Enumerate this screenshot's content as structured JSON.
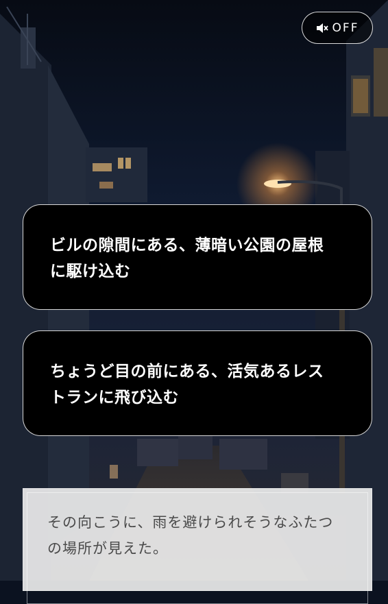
{
  "sound_toggle": {
    "icon": "speaker-mute-icon",
    "label": "OFF"
  },
  "choices": [
    {
      "text": "ビルの隙間にある、薄暗い公園の屋根に駆け込む"
    },
    {
      "text": "ちょうど目の前にある、活気あるレストランに飛び込む"
    }
  ],
  "message": {
    "text": "その向こうに、雨を避けられそうなふたつの場所が見えた。"
  },
  "colors": {
    "sky": "#0d1626",
    "choice_bg": "#000000",
    "choice_border": "#ffffff",
    "message_bg": "#ececec",
    "message_text": "#4a4a4a",
    "streetlight": "#ffb45a"
  }
}
